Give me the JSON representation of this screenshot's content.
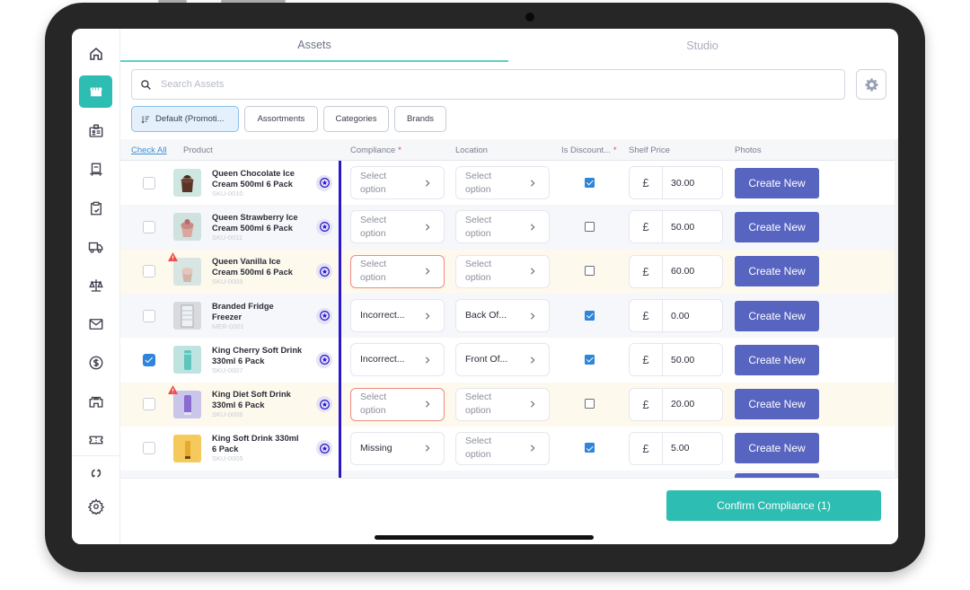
{
  "sidebar": {
    "items": [
      {
        "name": "home",
        "icon": "home-icon",
        "active": false
      },
      {
        "name": "store",
        "icon": "store-icon",
        "active": true
      },
      {
        "name": "id-badge",
        "icon": "id-badge-icon",
        "active": false
      },
      {
        "name": "kiosk",
        "icon": "kiosk-icon",
        "active": false
      },
      {
        "name": "clipboard-check",
        "icon": "clipboard-check-icon",
        "active": false
      },
      {
        "name": "delivery",
        "icon": "truck-icon",
        "active": false
      },
      {
        "name": "compliance-scale",
        "icon": "scale-icon",
        "active": false
      },
      {
        "name": "messages",
        "icon": "mail-icon",
        "active": false
      },
      {
        "name": "pricing",
        "icon": "dollar-icon",
        "active": false
      },
      {
        "name": "castle",
        "icon": "castle-icon",
        "active": false
      },
      {
        "name": "tickets",
        "icon": "ticket-icon",
        "active": false
      },
      {
        "name": "sync",
        "icon": "sync-icon",
        "active": false
      },
      {
        "name": "settings",
        "icon": "gear-icon",
        "active": false
      }
    ]
  },
  "tabs": [
    {
      "label": "Assets",
      "active": true
    },
    {
      "label": "Studio",
      "active": false
    }
  ],
  "search": {
    "placeholder": "Search Assets",
    "value": ""
  },
  "filters": {
    "sort_label": "Default (Promoti...",
    "chips": [
      "Assortments",
      "Categories",
      "Brands"
    ]
  },
  "table": {
    "columns": {
      "check_all": "Check All",
      "product": "Product",
      "compliance": "Compliance",
      "location": "Location",
      "discount": "Is Discount...",
      "shelf_price": "Shelf Price",
      "photos": "Photos",
      "required_mark": "*"
    },
    "currency_symbol": "£",
    "create_label": "Create New",
    "rows": [
      {
        "name_line1": "Queen Chocolate Ice",
        "name_line2": "Cream 500ml 6 Pack",
        "sku": "SKU-0010",
        "checked": false,
        "warning": false,
        "compliance": "Select option",
        "compliance_set": false,
        "compliance_error": false,
        "location": "Select option",
        "location_set": false,
        "discounted": true,
        "price": "30.00",
        "thumb": "chocolate"
      },
      {
        "name_line1": "Queen Strawberry Ice",
        "name_line2": "Cream 500ml 6 Pack",
        "sku": "SKU-0011",
        "checked": false,
        "warning": false,
        "compliance": "Select option",
        "compliance_set": false,
        "compliance_error": false,
        "location": "Select option",
        "location_set": false,
        "discounted": false,
        "price": "50.00",
        "thumb": "strawberry"
      },
      {
        "name_line1": "Queen Vanilla Ice",
        "name_line2": "Cream 500ml 6 Pack",
        "sku": "SKU-0009",
        "checked": false,
        "warning": true,
        "compliance": "Select option",
        "compliance_set": false,
        "compliance_error": true,
        "location": "Select option",
        "location_set": false,
        "discounted": false,
        "price": "60.00",
        "thumb": "vanilla"
      },
      {
        "name_line1": "Branded Fridge",
        "name_line2": "Freezer",
        "sku": "MER-0001",
        "checked": false,
        "warning": false,
        "compliance": "Incorrect...",
        "compliance_set": true,
        "compliance_error": false,
        "location": "Back Of...",
        "location_set": true,
        "discounted": true,
        "price": "0.00",
        "thumb": "fridge"
      },
      {
        "name_line1": "King Cherry Soft Drink",
        "name_line2": "330ml 6 Pack",
        "sku": "SKU-0007",
        "checked": true,
        "warning": false,
        "compliance": "Incorrect...",
        "compliance_set": true,
        "compliance_error": false,
        "location": "Front Of...",
        "location_set": true,
        "discounted": true,
        "price": "50.00",
        "thumb": "cherry"
      },
      {
        "name_line1": "King Diet Soft Drink",
        "name_line2": "330ml 6 Pack",
        "sku": "SKU-0006",
        "checked": false,
        "warning": true,
        "compliance": "Select option",
        "compliance_set": false,
        "compliance_error": true,
        "location": "Select option",
        "location_set": false,
        "discounted": false,
        "price": "20.00",
        "thumb": "diet"
      },
      {
        "name_line1": "King Soft Drink 330ml",
        "name_line2": "6 Pack",
        "sku": "SKU-0005",
        "checked": false,
        "warning": false,
        "compliance": "Missing",
        "compliance_set": true,
        "compliance_error": false,
        "location": "Select option",
        "location_set": false,
        "discounted": true,
        "price": "5.00",
        "thumb": "king"
      }
    ]
  },
  "footer": {
    "confirm_label": "Confirm Compliance (1)"
  },
  "colors": {
    "accent": "#2dbdb2",
    "primary_button": "#5764c0",
    "checkbox": "#2f86d8",
    "error_border": "#ee8a86",
    "warning_row": "#fef9ed",
    "divider": "#2a17c9"
  }
}
